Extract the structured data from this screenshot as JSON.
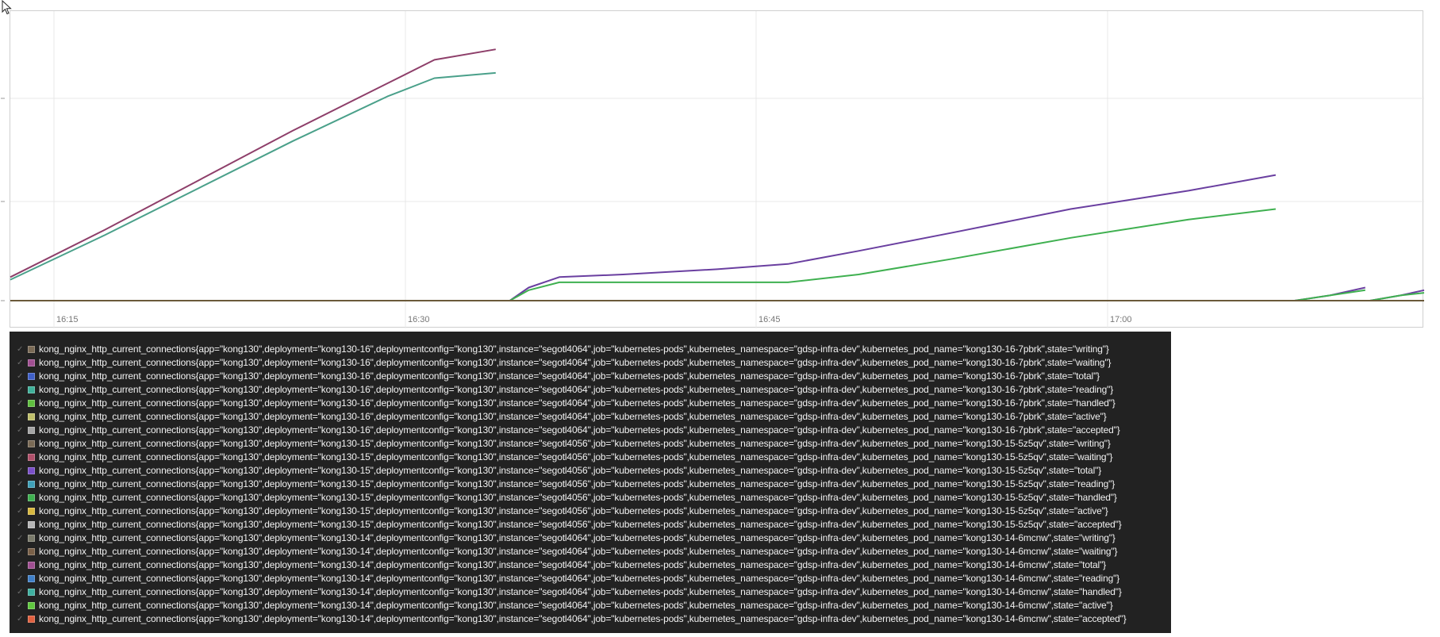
{
  "chart_data": {
    "type": "line",
    "x_axis": {
      "ticks": [
        "16:15",
        "16:30",
        "16:45",
        "17:00"
      ]
    },
    "y_axis": {
      "tick_labels": [
        "",
        "",
        "",
        ""
      ]
    },
    "grid": true,
    "series": [
      {
        "color": "#8e3f6a",
        "points": [
          [
            0,
            0.09
          ],
          [
            4,
            0.27
          ],
          [
            8,
            0.46
          ],
          [
            12,
            0.65
          ],
          [
            16,
            0.83
          ],
          [
            18,
            0.92
          ],
          [
            20.6,
            0.96
          ]
        ]
      },
      {
        "color": "#4aa08a",
        "points": [
          [
            0,
            0.08
          ],
          [
            4,
            0.25
          ],
          [
            8,
            0.43
          ],
          [
            12,
            0.61
          ],
          [
            16,
            0.78
          ],
          [
            18,
            0.85
          ],
          [
            20.6,
            0.87
          ]
        ]
      },
      {
        "color": "#6a3fa0",
        "points": [
          [
            20.6,
            0.0
          ],
          [
            21.2,
            0.0
          ],
          [
            22,
            0.05
          ],
          [
            23.3,
            0.09
          ],
          [
            26,
            0.1
          ],
          [
            30,
            0.12
          ],
          [
            33,
            0.14
          ],
          [
            36,
            0.19
          ],
          [
            40,
            0.26
          ],
          [
            45,
            0.35
          ],
          [
            50,
            0.42
          ],
          [
            53.7,
            0.48
          ]
        ]
      },
      {
        "color": "#3fb050",
        "points": [
          [
            20.6,
            0.0
          ],
          [
            21.2,
            0.0
          ],
          [
            22,
            0.04
          ],
          [
            23.3,
            0.07
          ],
          [
            26,
            0.07
          ],
          [
            30,
            0.07
          ],
          [
            33,
            0.07
          ],
          [
            36,
            0.1
          ],
          [
            40,
            0.16
          ],
          [
            45,
            0.24
          ],
          [
            50,
            0.31
          ],
          [
            53.7,
            0.35
          ]
        ]
      },
      {
        "color": "#6a3fa0",
        "points": [
          [
            54.5,
            0.0
          ],
          [
            56,
            0.02
          ],
          [
            57.5,
            0.05
          ]
        ]
      },
      {
        "color": "#3fb050",
        "points": [
          [
            54.5,
            0.0
          ],
          [
            56,
            0.02
          ],
          [
            57.5,
            0.04
          ]
        ]
      },
      {
        "color": "#6a3fa0",
        "points": [
          [
            57.7,
            0.0
          ],
          [
            59,
            0.02
          ],
          [
            60,
            0.04
          ]
        ]
      },
      {
        "color": "#3fb050",
        "points": [
          [
            57.7,
            0.0
          ],
          [
            59,
            0.02
          ],
          [
            60,
            0.03
          ]
        ]
      },
      {
        "color": "#6b5a3a",
        "points": [
          [
            0,
            0.0
          ],
          [
            60,
            0.0
          ]
        ]
      }
    ]
  },
  "legend": [
    {
      "color": "#7a6a55",
      "label": "kong_nginx_http_current_connections{app=\"kong130\",deployment=\"kong130-16\",deploymentconfig=\"kong130\",instance=\"segotl4064\",job=\"kubernetes-pods\",kubernetes_namespace=\"gdsp-infra-dev\",kubernetes_pod_name=\"kong130-16-7pbrk\",state=\"writing\"}"
    },
    {
      "color": "#a04f92",
      "label": "kong_nginx_http_current_connections{app=\"kong130\",deployment=\"kong130-16\",deploymentconfig=\"kong130\",instance=\"segotl4064\",job=\"kubernetes-pods\",kubernetes_namespace=\"gdsp-infra-dev\",kubernetes_pod_name=\"kong130-16-7pbrk\",state=\"waiting\"}"
    },
    {
      "color": "#3f5fc8",
      "label": "kong_nginx_http_current_connections{app=\"kong130\",deployment=\"kong130-16\",deploymentconfig=\"kong130\",instance=\"segotl4064\",job=\"kubernetes-pods\",kubernetes_namespace=\"gdsp-infra-dev\",kubernetes_pod_name=\"kong130-16-7pbrk\",state=\"total\"}"
    },
    {
      "color": "#3fb09a",
      "label": "kong_nginx_http_current_connections{app=\"kong130\",deployment=\"kong130-16\",deploymentconfig=\"kong130\",instance=\"segotl4064\",job=\"kubernetes-pods\",kubernetes_namespace=\"gdsp-infra-dev\",kubernetes_pod_name=\"kong130-16-7pbrk\",state=\"reading\"}"
    },
    {
      "color": "#5fbf3f",
      "label": "kong_nginx_http_current_connections{app=\"kong130\",deployment=\"kong130-16\",deploymentconfig=\"kong130\",instance=\"segotl4064\",job=\"kubernetes-pods\",kubernetes_namespace=\"gdsp-infra-dev\",kubernetes_pod_name=\"kong130-16-7pbrk\",state=\"handled\"}"
    },
    {
      "color": "#bfbf6a",
      "label": "kong_nginx_http_current_connections{app=\"kong130\",deployment=\"kong130-16\",deploymentconfig=\"kong130\",instance=\"segotl4064\",job=\"kubernetes-pods\",kubernetes_namespace=\"gdsp-infra-dev\",kubernetes_pod_name=\"kong130-16-7pbrk\",state=\"active\"}"
    },
    {
      "color": "#a5a5a5",
      "label": "kong_nginx_http_current_connections{app=\"kong130\",deployment=\"kong130-16\",deploymentconfig=\"kong130\",instance=\"segotl4064\",job=\"kubernetes-pods\",kubernetes_namespace=\"gdsp-infra-dev\",kubernetes_pod_name=\"kong130-16-7pbrk\",state=\"accepted\"}"
    },
    {
      "color": "#7a6a55",
      "label": "kong_nginx_http_current_connections{app=\"kong130\",deployment=\"kong130-15\",deploymentconfig=\"kong130\",instance=\"segotl4056\",job=\"kubernetes-pods\",kubernetes_namespace=\"gdsp-infra-dev\",kubernetes_pod_name=\"kong130-15-5z5qv\",state=\"writing\"}"
    },
    {
      "color": "#b0506a",
      "label": "kong_nginx_http_current_connections{app=\"kong130\",deployment=\"kong130-15\",deploymentconfig=\"kong130\",instance=\"segotl4056\",job=\"kubernetes-pods\",kubernetes_namespace=\"gdsp-infra-dev\",kubernetes_pod_name=\"kong130-15-5z5qv\",state=\"waiting\"}"
    },
    {
      "color": "#7a4fc8",
      "label": "kong_nginx_http_current_connections{app=\"kong130\",deployment=\"kong130-15\",deploymentconfig=\"kong130\",instance=\"segotl4056\",job=\"kubernetes-pods\",kubernetes_namespace=\"gdsp-infra-dev\",kubernetes_pod_name=\"kong130-15-5z5qv\",state=\"total\"}"
    },
    {
      "color": "#3fa0b8",
      "label": "kong_nginx_http_current_connections{app=\"kong130\",deployment=\"kong130-15\",deploymentconfig=\"kong130\",instance=\"segotl4056\",job=\"kubernetes-pods\",kubernetes_namespace=\"gdsp-infra-dev\",kubernetes_pod_name=\"kong130-15-5z5qv\",state=\"reading\"}"
    },
    {
      "color": "#3fb050",
      "label": "kong_nginx_http_current_connections{app=\"kong130\",deployment=\"kong130-15\",deploymentconfig=\"kong130\",instance=\"segotl4056\",job=\"kubernetes-pods\",kubernetes_namespace=\"gdsp-infra-dev\",kubernetes_pod_name=\"kong130-15-5z5qv\",state=\"handled\"}"
    },
    {
      "color": "#d8b83f",
      "label": "kong_nginx_http_current_connections{app=\"kong130\",deployment=\"kong130-15\",deploymentconfig=\"kong130\",instance=\"segotl4056\",job=\"kubernetes-pods\",kubernetes_namespace=\"gdsp-infra-dev\",kubernetes_pod_name=\"kong130-15-5z5qv\",state=\"active\"}"
    },
    {
      "color": "#b5b5b5",
      "label": "kong_nginx_http_current_connections{app=\"kong130\",deployment=\"kong130-15\",deploymentconfig=\"kong130\",instance=\"segotl4056\",job=\"kubernetes-pods\",kubernetes_namespace=\"gdsp-infra-dev\",kubernetes_pod_name=\"kong130-15-5z5qv\",state=\"accepted\"}"
    },
    {
      "color": "#7a7a6a",
      "label": "kong_nginx_http_current_connections{app=\"kong130\",deployment=\"kong130-14\",deploymentconfig=\"kong130\",instance=\"segotl4064\",job=\"kubernetes-pods\",kubernetes_namespace=\"gdsp-infra-dev\",kubernetes_pod_name=\"kong130-14-6mcnw\",state=\"writing\"}"
    },
    {
      "color": "#7a6048",
      "label": "kong_nginx_http_current_connections{app=\"kong130\",deployment=\"kong130-14\",deploymentconfig=\"kong130\",instance=\"segotl4064\",job=\"kubernetes-pods\",kubernetes_namespace=\"gdsp-infra-dev\",kubernetes_pod_name=\"kong130-14-6mcnw\",state=\"waiting\"}"
    },
    {
      "color": "#a04f92",
      "label": "kong_nginx_http_current_connections{app=\"kong130\",deployment=\"kong130-14\",deploymentconfig=\"kong130\",instance=\"segotl4064\",job=\"kubernetes-pods\",kubernetes_namespace=\"gdsp-infra-dev\",kubernetes_pod_name=\"kong130-14-6mcnw\",state=\"total\"}"
    },
    {
      "color": "#3f7fc8",
      "label": "kong_nginx_http_current_connections{app=\"kong130\",deployment=\"kong130-14\",deploymentconfig=\"kong130\",instance=\"segotl4064\",job=\"kubernetes-pods\",kubernetes_namespace=\"gdsp-infra-dev\",kubernetes_pod_name=\"kong130-14-6mcnw\",state=\"reading\"}"
    },
    {
      "color": "#3fb0a0",
      "label": "kong_nginx_http_current_connections{app=\"kong130\",deployment=\"kong130-14\",deploymentconfig=\"kong130\",instance=\"segotl4064\",job=\"kubernetes-pods\",kubernetes_namespace=\"gdsp-infra-dev\",kubernetes_pod_name=\"kong130-14-6mcnw\",state=\"handled\"}"
    },
    {
      "color": "#5fc83f",
      "label": "kong_nginx_http_current_connections{app=\"kong130\",deployment=\"kong130-14\",deploymentconfig=\"kong130\",instance=\"segotl4064\",job=\"kubernetes-pods\",kubernetes_namespace=\"gdsp-infra-dev\",kubernetes_pod_name=\"kong130-14-6mcnw\",state=\"active\"}"
    },
    {
      "color": "#e0603f",
      "label": "kong_nginx_http_current_connections{app=\"kong130\",deployment=\"kong130-14\",deploymentconfig=\"kong130\",instance=\"segotl4064\",job=\"kubernetes-pods\",kubernetes_namespace=\"gdsp-infra-dev\",kubernetes_pod_name=\"kong130-14-6mcnw\",state=\"accepted\"}"
    }
  ]
}
